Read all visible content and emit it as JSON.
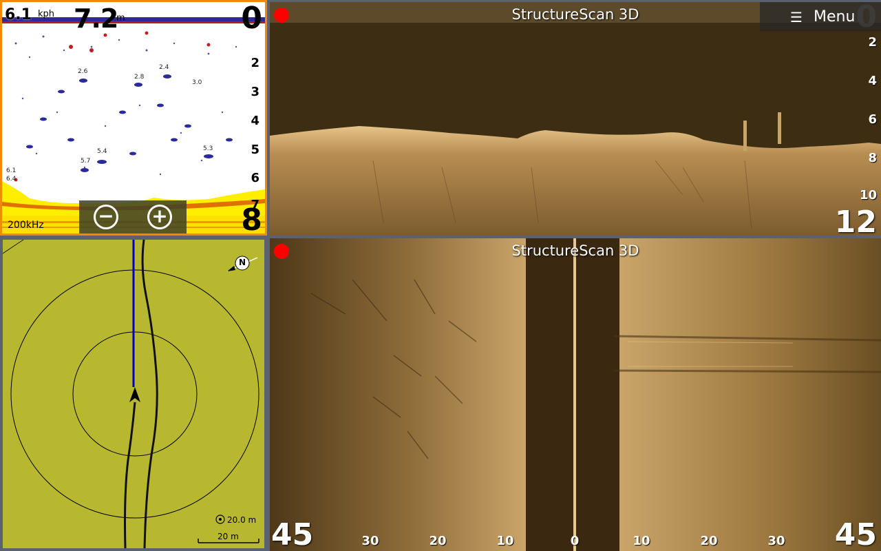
{
  "sonar": {
    "speed": "6.1",
    "speed_unit": "kph",
    "depth": "7.2",
    "depth_unit": "m",
    "range_top": "0",
    "range_bottom": "8",
    "scale": [
      "2",
      "3",
      "4",
      "5",
      "6",
      "7"
    ],
    "frequency": "200kHz",
    "fish_labels": [
      "2.6",
      "2.8",
      "2.4",
      "3.0",
      "5.7",
      "5.4",
      "5.3",
      "6.1",
      "6.4"
    ],
    "zoom_out_icon": "minus-circle-icon",
    "zoom_in_icon": "plus-circle-icon",
    "colors": {
      "border": "#f08a00",
      "bottom": "#ffee00",
      "fish": "#2a2a9a"
    }
  },
  "down_scan": {
    "title": "StructureScan 3D",
    "range_top": "0",
    "range_bottom": "12",
    "scale": [
      "2",
      "4",
      "6",
      "8",
      "10"
    ],
    "record_indicator": "record-dot",
    "colors": {
      "water": "#3d2d12",
      "bottom": "#c9a060"
    }
  },
  "menu": {
    "label": "Menu",
    "icon": "hamburger-icon"
  },
  "map": {
    "north_label": "N",
    "range_label": "20.0 m",
    "scale_label": "20 m",
    "colors": {
      "background": "#b8b830",
      "heading_line": "#0000cc"
    }
  },
  "side_scan": {
    "title": "StructureScan 3D",
    "range_left": "45",
    "range_right": "45",
    "ticks": [
      "30",
      "20",
      "10",
      "0",
      "10",
      "20",
      "30"
    ]
  }
}
